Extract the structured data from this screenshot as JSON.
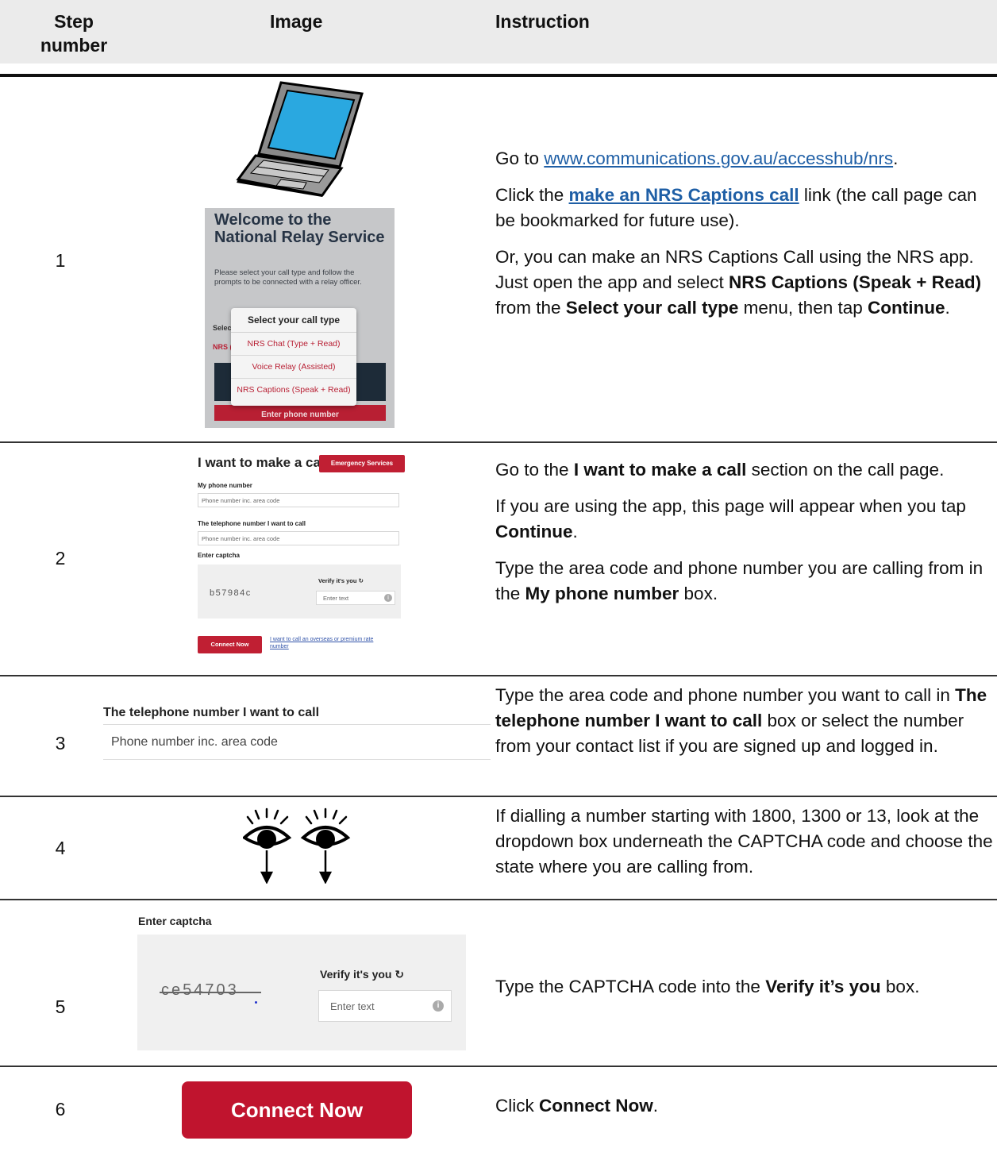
{
  "header": {
    "step_col_line1": "Step",
    "step_col_line2": "number",
    "image_col": "Image",
    "instruction_col": "Instruction"
  },
  "rows": [
    {
      "step": "1",
      "icon": "laptop-icon",
      "app_screenshot": {
        "title": "Welcome to the National Relay Service",
        "subtitle": "Please select your call type and follow the prompts to be connected with a relay officer.",
        "select_label_partial": "Selec",
        "nrs_partial": "NRS (",
        "popup_title": "Select your call type",
        "options": [
          "NRS Chat (Type + Read)",
          "Voice Relay (Assisted)",
          "NRS Captions (Speak + Read)"
        ],
        "enter_phone": "Enter phone number"
      },
      "instruction": {
        "p1_pre": "Go to ",
        "p1_link": "www.communications.gov.au/accesshub/nrs",
        "p1_post": ".",
        "p2_pre": "Click the ",
        "p2_link": "make an NRS Captions call",
        "p2_post": " link (the call page can be bookmarked for future use).",
        "p3_a": "Or, you can make an NRS Captions Call using the NRS app. Just open the app and select ",
        "p3_b1": "NRS Captions (Speak + Read)",
        "p3_c": " from the ",
        "p3_b2": "Select your call type",
        "p3_d": " menu, then tap ",
        "p3_b3": "Continue",
        "p3_e": "."
      }
    },
    {
      "step": "2",
      "form": {
        "title": "I want to make a call",
        "emergency": "Emergency Services",
        "my_phone_label": "My phone number",
        "my_phone_placeholder": "Phone number inc. area code",
        "dest_label": "The telephone number I want to call",
        "dest_placeholder": "Phone number inc. area code",
        "captcha_label": "Enter captcha",
        "captcha_code": "b57984c",
        "verify_label": "Verify it's you",
        "verify_placeholder": "Enter text",
        "connect": "Connect Now",
        "overseas_link": "I want to call an overseas or premium rate number"
      },
      "instruction": {
        "p1_a": "Go to the ",
        "p1_b": "I want to make a call",
        "p1_c": " section on the call page.",
        "p2_a": "If you are using the app, this page will appear when you tap ",
        "p2_b": "Continue",
        "p2_c": ".",
        "p3_a": "Type the area code and phone number you are calling from in the ",
        "p3_b": "My phone number",
        "p3_c": " box."
      }
    },
    {
      "step": "3",
      "crop": {
        "label": "The telephone number I want to call",
        "placeholder": "Phone number inc. area code"
      },
      "instruction": {
        "a": "Type the area code and phone number you want to call in ",
        "b": "The telephone number I want to call",
        "c": " box or select the number from your contact list if you are signed up and logged in."
      }
    },
    {
      "step": "4",
      "icon": "eyes-looking-down-icon",
      "instruction": {
        "text": "If dialling a number starting with 1800, 1300 or 13, look at the dropdown box underneath the CAPTCHA code and choose the state where you are calling from."
      }
    },
    {
      "step": "5",
      "captcha": {
        "label": "Enter captcha",
        "code": "ce54703",
        "verify_label": "Verify it's you",
        "placeholder": "Enter text"
      },
      "instruction": {
        "a": "Type the CAPTCHA code into the ",
        "b": "Verify it’s you",
        "c": " box."
      }
    },
    {
      "step": "6",
      "button": "Connect Now",
      "instruction": {
        "a": "Click ",
        "b": "Connect Now",
        "c": "."
      }
    }
  ],
  "colors": {
    "header_bg": "#ebebeb",
    "link": "#1f5fa6",
    "relay_red": "#c0142e",
    "app_navy": "#273445"
  }
}
